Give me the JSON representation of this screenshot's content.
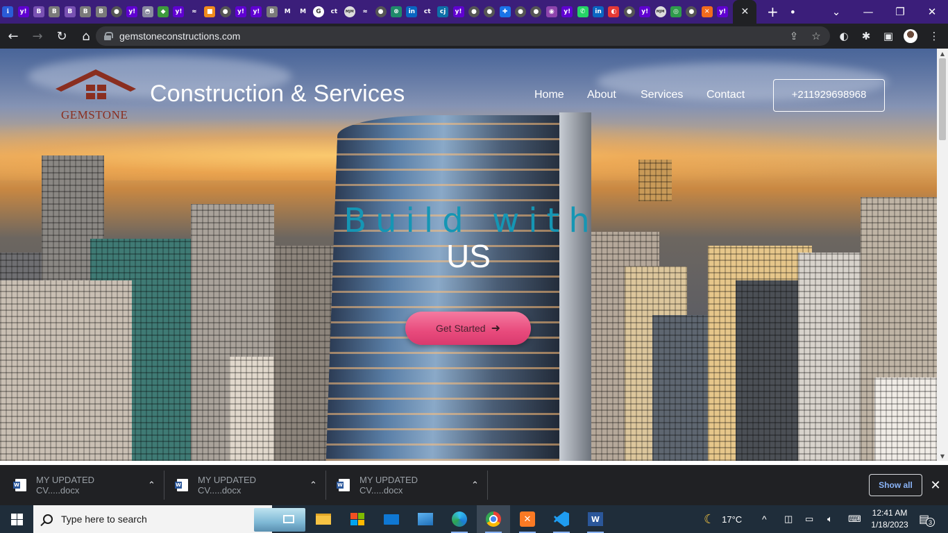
{
  "browser": {
    "tab_favicons": [
      {
        "glyph": "ℹ",
        "bg": "#2a5bd7"
      },
      {
        "glyph": "y!",
        "bg": "#6001d2"
      },
      {
        "glyph": "B",
        "bg": "#7952b3"
      },
      {
        "glyph": "B",
        "bg": "#7a7a7a"
      },
      {
        "glyph": "B",
        "bg": "#7952b3"
      },
      {
        "glyph": "B",
        "bg": "#7a7a7a"
      },
      {
        "glyph": "B",
        "bg": "#7a7a7a"
      },
      {
        "glyph": "●",
        "bg": "#555555"
      },
      {
        "glyph": "y!",
        "bg": "#6001d2"
      },
      {
        "glyph": "◓",
        "bg": "#8a8aa0"
      },
      {
        "glyph": "◆",
        "bg": "#3d9a3d"
      },
      {
        "glyph": "y!",
        "bg": "#6001d2"
      },
      {
        "glyph": "≈",
        "bg": "#3b1e7a"
      },
      {
        "glyph": "■",
        "bg": "#f08a1c"
      },
      {
        "glyph": "●",
        "bg": "#555555"
      },
      {
        "glyph": "y!",
        "bg": "#6001d2"
      },
      {
        "glyph": "y!",
        "bg": "#6001d2"
      },
      {
        "glyph": "B",
        "bg": "#7a7a7a"
      },
      {
        "glyph": "M",
        "bg": "#3b1e7a"
      },
      {
        "glyph": "M",
        "bg": "#3b1e7a"
      },
      {
        "glyph": "G",
        "bg": "#ffffff"
      },
      {
        "glyph": "ct",
        "bg": "#3b1e7a"
      },
      {
        "glyph": "MJM",
        "bg": "#dddddd"
      },
      {
        "glyph": "≈",
        "bg": "#3b1e7a"
      },
      {
        "glyph": "●",
        "bg": "#555555"
      },
      {
        "glyph": "⊗",
        "bg": "#1f8a6a"
      },
      {
        "glyph": "in",
        "bg": "#0a66c2"
      },
      {
        "glyph": "ct",
        "bg": "#3b1e7a"
      },
      {
        "glyph": "cj",
        "bg": "#0e6fa8"
      },
      {
        "glyph": "y!",
        "bg": "#6001d2"
      },
      {
        "glyph": "●",
        "bg": "#555555"
      },
      {
        "glyph": "●",
        "bg": "#555555"
      },
      {
        "glyph": "✚",
        "bg": "#1a73e8"
      },
      {
        "glyph": "●",
        "bg": "#555555"
      },
      {
        "glyph": "●",
        "bg": "#555555"
      },
      {
        "glyph": "◉",
        "bg": "#8e44ad"
      },
      {
        "glyph": "y!",
        "bg": "#6001d2"
      },
      {
        "glyph": "✆",
        "bg": "#25d366"
      },
      {
        "glyph": "in",
        "bg": "#0a66c2"
      },
      {
        "glyph": "◐",
        "bg": "#e53935"
      },
      {
        "glyph": "●",
        "bg": "#555555"
      },
      {
        "glyph": "y!",
        "bg": "#6001d2"
      },
      {
        "glyph": "MJM",
        "bg": "#dddddd"
      },
      {
        "glyph": "◎",
        "bg": "#2e9b4b"
      },
      {
        "glyph": "●",
        "bg": "#555555"
      },
      {
        "glyph": "✕",
        "bg": "#f26b1d"
      },
      {
        "glyph": "y!",
        "bg": "#6001d2"
      }
    ],
    "active_tab_close": "✕",
    "new_tab": "+",
    "window_controls": {
      "minimize": "—",
      "restore": "❐",
      "close": "✕",
      "chevron": "⌄"
    },
    "url": "gemstoneconstructions.com"
  },
  "site": {
    "logo_text": "GEMSTONE",
    "title": "Construction & Services",
    "nav": [
      "Home",
      "About",
      "Services",
      "Contact"
    ],
    "phone": "+211929698968",
    "hero_line1": "Build with",
    "hero_line2": "US",
    "cta": "Get Started",
    "cta_arrow": "➜"
  },
  "downloads": {
    "items": [
      "MY UPDATED CV.....docx",
      "MY UPDATED CV.....docx",
      "MY UPDATED CV.....docx"
    ],
    "show_all": "Show all",
    "close": "✕"
  },
  "taskbar": {
    "search_placeholder": "Type here to search",
    "weather": "17°C",
    "time": "12:41 AM",
    "date": "1/18/2023",
    "notifications": "3"
  },
  "colors": {
    "tab_strip": "#3b1e7a",
    "hero_accent": "#1596b4",
    "cta_pink": "#e84a7c",
    "logo_brown": "#8a2e1f"
  }
}
